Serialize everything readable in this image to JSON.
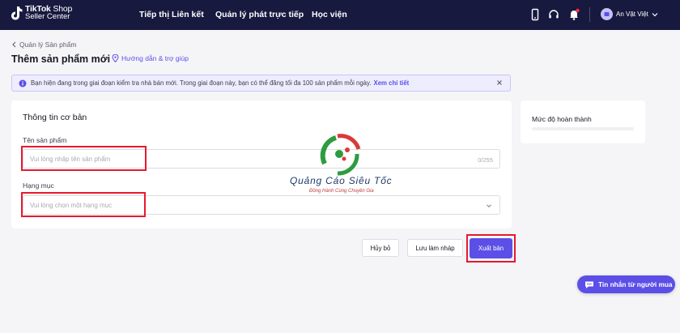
{
  "header": {
    "logo_line1_brand": "TikTok",
    "logo_line1_rest": " Shop",
    "logo_line2": "Seller Center",
    "nav": [
      {
        "label": "Tiếp thị Liên kết"
      },
      {
        "label": "Quản lý phát trực tiếp"
      },
      {
        "label": "Học viện"
      }
    ],
    "icons": [
      "phone-icon",
      "headset-icon",
      "bell-icon"
    ],
    "notification_dot_color": "#fe2c55",
    "user_name": "An Vặt Việt"
  },
  "breadcrumb": "Quản lý Sản phẩm",
  "page_title": "Thêm sản phẩm mới",
  "help_link": "Hướng dẫn & trợ giúp",
  "notice": {
    "text": "Bạn hiện đang trong giai đoạn kiểm tra nhà bán mới. Trong giai đoạn này, bạn có thể đăng tối đa 100 sản phẩm mỗi ngày.",
    "link": "Xem chi tiết"
  },
  "basic_info": {
    "title": "Thông tin cơ bản",
    "name_label": "Tên sản phẩm",
    "name_placeholder": "Vui lòng nhập tên sản phẩm",
    "name_counter": "0/255",
    "category_label": "Hạng mục",
    "category_placeholder": "Vui lòng chọn một hạng mục"
  },
  "watermark": {
    "title": "Quảng Cáo Siêu Tốc",
    "subtitle": "Đồng Hành Cùng Chuyên Gia"
  },
  "actions": {
    "cancel": "Hủy bỏ",
    "save_draft": "Lưu làm nháp",
    "publish": "Xuất bản"
  },
  "completion": {
    "title": "Mức độ hoàn thành"
  },
  "chat_button": "Tin nhắn từ người mua",
  "colors": {
    "header_bg": "#18193f",
    "accent": "#5b4fe7",
    "highlight": "#e8192c"
  }
}
